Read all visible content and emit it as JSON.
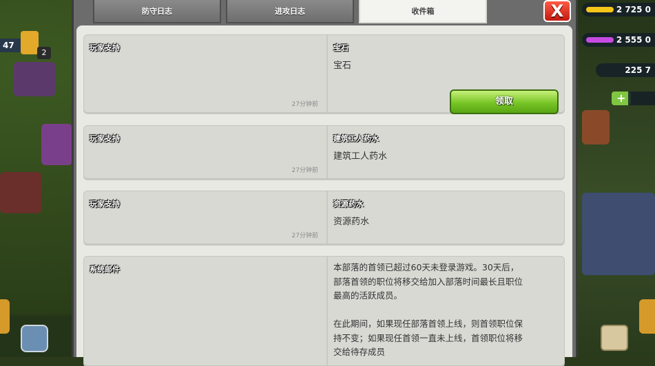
{
  "hud": {
    "level": "47",
    "trophy_badge": "2",
    "gold": "2 725 0",
    "elixir": "2 555 0",
    "dark_elixir": "225 7",
    "plus": "+",
    "colors": {
      "gold": "#f5c518",
      "elixir": "#c64be3",
      "dark": "#333"
    }
  },
  "tabs": [
    {
      "label": "防守日志"
    },
    {
      "label": "进攻日志"
    },
    {
      "label": "收件箱"
    }
  ],
  "close_label": "X",
  "messages": [
    {
      "sender": "玩家支持",
      "time": "27分钟前",
      "title": "宝石",
      "body": "宝石",
      "button": "领取"
    },
    {
      "sender": "玩家支持",
      "time": "27分钟前",
      "title": "建筑工人药水",
      "body": "建筑工人药水"
    },
    {
      "sender": "玩家支持",
      "time": "27分钟前",
      "title": "资源药水",
      "body": "资源药水"
    },
    {
      "sender": "系统邮件",
      "text": "本部落的首领已超过60天未登录游戏。30天后，\n部落首领的职位将移交给加入部落时间最长且职位\n最高的活跃成员。\n\n在此期间，如果现任部落首领上线，则首领职位保\n持不变；如果现任首领一直未上线，首领职位将移\n交给待存成员"
    }
  ]
}
